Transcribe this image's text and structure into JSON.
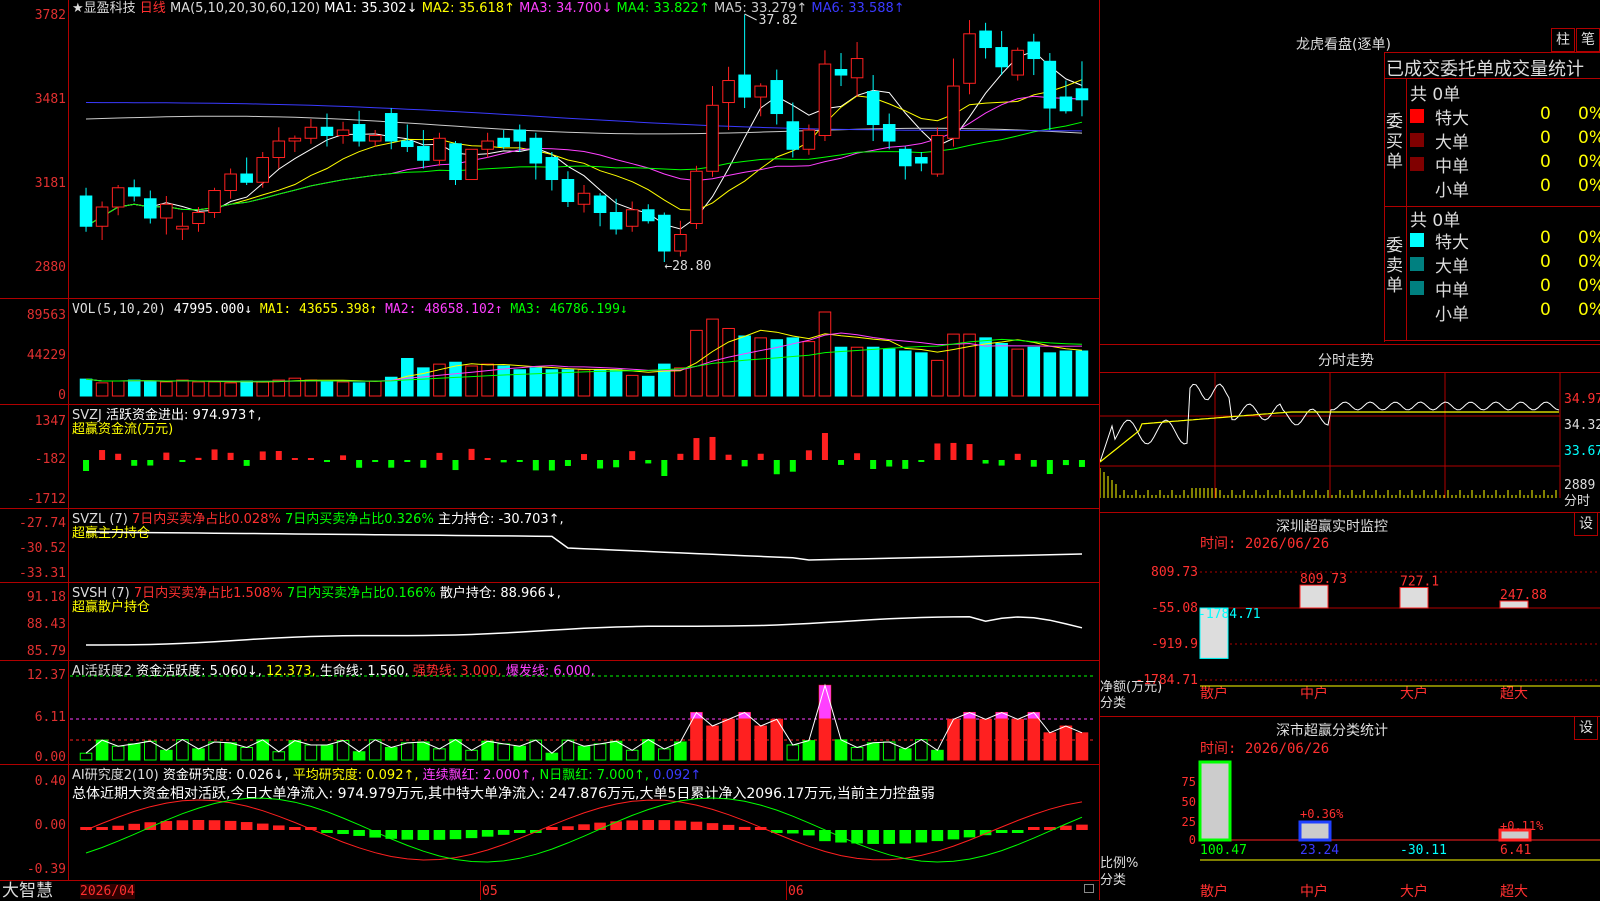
{
  "stock": {
    "title": "★显盈科技",
    "period": "日线",
    "ma_label": "MA(5,10,20,30,60,120)",
    "ma1": "MA1: 35.302↓",
    "ma2": "MA2: 35.618↑",
    "ma3": "MA3: 34.700↓",
    "ma4": "MA4: 33.822↑",
    "ma5": "MA5: 33.279↑",
    "ma6": "MA6: 33.588↑",
    "high_mark": "37.82",
    "low_mark": "←28.80",
    "y_labels": [
      "3782",
      "3481",
      "3181",
      "2880"
    ]
  },
  "vol": {
    "label": "VOL(5,10,20)",
    "value": "47995.000↓",
    "ma1": "MA1: 43655.398↑",
    "ma2": "MA2: 48658.102↑",
    "ma3": "MA3: 46786.199↓",
    "y_labels": [
      "89563",
      "44229",
      "0"
    ]
  },
  "svzj": {
    "label": "SVZJ",
    "desc": "活跃资金进出: 974.973↑,",
    "sub": "超赢资金流(万元)",
    "y_labels": [
      "1347",
      "-182",
      "-1712"
    ]
  },
  "svzl": {
    "label": "SVZL (7)",
    "t1": "7日内买卖净占比0.028%",
    "t2": "7日内买卖净占比0.326%",
    "t3": "主力持仓: -30.703↑,",
    "sub": "超赢主力持仓",
    "y_labels": [
      "-27.74",
      "-30.52",
      "-33.31"
    ]
  },
  "svsh": {
    "label": "SVSH (7)",
    "t1": "7日内买卖净占比1.508%",
    "t2": "7日内买卖净占比0.166%",
    "t3": "散户持仓: 88.966↓,",
    "sub": "超赢散户持仓",
    "y_labels": [
      "91.18",
      "88.43",
      "85.79"
    ]
  },
  "ai2": {
    "label": "AI活跃度2",
    "t1": "资金活跃度: 5.060↓,",
    "t2": "12.373,",
    "t3": "生命线: 1.560,",
    "t4": "强势线: 3.000,",
    "t5": "爆发线: 6.000,",
    "y_labels": [
      "12.37",
      "6.11",
      "0.00"
    ]
  },
  "ai_research": {
    "label": "AI研究度2(10)",
    "t1": "资金研究度: 0.026↓,",
    "t2": "平均研究度: 0.092↑,",
    "t3": "连续飘红: 2.000↑,",
    "t4": "N日飘红: 7.000↑,",
    "t5": "0.092↑",
    "summary": "总体近期大资金相对活跃,今日大单净流入: 974.979万元,其中特大单净流入: 247.876万元,大单5日累计净入2096.17万元,当前主力控盘弱",
    "y_labels": [
      "0.40",
      "0.00",
      "-0.39"
    ]
  },
  "footer": {
    "brand": "大智慧",
    "dates": [
      "2026/04",
      "05",
      "06"
    ]
  },
  "longhu": {
    "title": "龙虎看盘(逐单)",
    "btn_bar": "柱",
    "btn_note": "笔",
    "header": "已成交委托单成交量统计",
    "buy_label": "委买单",
    "sell_label": "委卖单",
    "buy_total": "共 0单",
    "sell_total": "共 0单",
    "buy_rows": [
      {
        "name": "特大",
        "count": "0",
        "pct": "0%",
        "color": "#ff0000"
      },
      {
        "name": "大单",
        "count": "0",
        "pct": "0%",
        "color": "#800000"
      },
      {
        "name": "中单",
        "count": "0",
        "pct": "0%",
        "color": "#800000"
      },
      {
        "name": "小单",
        "count": "0",
        "pct": "0%",
        "color": ""
      }
    ],
    "sell_rows": [
      {
        "name": "特大",
        "count": "0",
        "pct": "0%",
        "color": "#00ffff"
      },
      {
        "name": "大单",
        "count": "0",
        "pct": "0%",
        "color": "#008080"
      },
      {
        "name": "中单",
        "count": "0",
        "pct": "0%",
        "color": "#008080"
      },
      {
        "name": "小单",
        "count": "0",
        "pct": "0%",
        "color": ""
      }
    ]
  },
  "intraday": {
    "title": "分时走势",
    "y_labels": [
      "34.97",
      "34.32",
      "33.67"
    ],
    "vol_label": "2889",
    "time_label": "分时"
  },
  "sz_monitor": {
    "title": "深圳超赢实时监控",
    "btn": "设",
    "time": "时间: 2026/06/26",
    "y_labels": [
      "809.73",
      "-55.08",
      "-919.9",
      "-1784.71"
    ],
    "footer_left1": "净额(万元)",
    "footer_left2": "分类",
    "categories": [
      "散户",
      "中户",
      "大户",
      "超大"
    ],
    "values": [
      "-1784.71",
      "809.73",
      "727.1",
      "247.88"
    ]
  },
  "sz_stats": {
    "title": "深市超赢分类统计",
    "btn": "设",
    "time": "时间: 2026/06/26",
    "y_labels": [
      "75",
      "50",
      "25",
      "0"
    ],
    "footer_left1": "比例%",
    "footer_left2": "分类",
    "categories": [
      "散户",
      "中户",
      "大户",
      "超大"
    ],
    "values": [
      "100.47",
      "23.24",
      "-30.11",
      "6.41"
    ],
    "annotations": [
      "+0.36%",
      "+0.11%"
    ]
  },
  "colors": {
    "up": "#ff2020",
    "down": "#00ffff",
    "grid": "#b00000",
    "label_red": "#e03030",
    "yellow": "#ffff00",
    "magenta": "#ff40ff",
    "green": "#00ff00"
  },
  "chart_data": {
    "type": "line",
    "title": "",
    "candles": [
      [
        31.2,
        31.5,
        29.9,
        30.1
      ],
      [
        30.1,
        31.0,
        29.6,
        30.8
      ],
      [
        30.8,
        31.6,
        30.5,
        31.5
      ],
      [
        31.5,
        31.8,
        31.0,
        31.2
      ],
      [
        31.1,
        31.4,
        30.2,
        30.4
      ],
      [
        30.4,
        31.2,
        29.8,
        30.9
      ],
      [
        30.0,
        30.6,
        29.6,
        30.1
      ],
      [
        30.2,
        30.8,
        29.9,
        30.6
      ],
      [
        30.6,
        31.5,
        30.4,
        31.4
      ],
      [
        31.4,
        32.2,
        31.1,
        32.0
      ],
      [
        32.0,
        32.6,
        31.6,
        31.7
      ],
      [
        31.7,
        32.8,
        31.5,
        32.6
      ],
      [
        32.6,
        33.7,
        32.2,
        33.2
      ],
      [
        33.2,
        33.4,
        32.8,
        33.3
      ],
      [
        33.3,
        34.0,
        33.1,
        33.7
      ],
      [
        33.7,
        34.2,
        33.0,
        33.4
      ],
      [
        33.4,
        33.9,
        33.1,
        33.6
      ],
      [
        33.8,
        34.3,
        33.0,
        33.2
      ],
      [
        33.2,
        33.6,
        33.0,
        33.4
      ],
      [
        34.2,
        34.4,
        32.9,
        33.2
      ],
      [
        33.2,
        33.8,
        32.8,
        33.0
      ],
      [
        33.0,
        33.6,
        32.2,
        32.5
      ],
      [
        32.5,
        33.5,
        32.3,
        33.3
      ],
      [
        33.1,
        33.2,
        31.6,
        31.8
      ],
      [
        31.8,
        32.9,
        31.8,
        32.9
      ],
      [
        32.9,
        33.5,
        32.6,
        33.2
      ],
      [
        33.3,
        33.6,
        32.9,
        33.0
      ],
      [
        33.6,
        33.8,
        32.8,
        33.2
      ],
      [
        33.3,
        33.5,
        31.8,
        32.4
      ],
      [
        32.6,
        32.8,
        31.4,
        31.8
      ],
      [
        31.8,
        32.1,
        30.8,
        31.0
      ],
      [
        30.9,
        31.6,
        30.6,
        31.3
      ],
      [
        31.2,
        31.3,
        30.1,
        30.6
      ],
      [
        30.6,
        31.1,
        29.8,
        30.0
      ],
      [
        30.1,
        31.0,
        29.9,
        30.7
      ],
      [
        30.7,
        30.9,
        30.2,
        30.3
      ],
      [
        30.5,
        30.6,
        28.8,
        29.2
      ],
      [
        29.2,
        30.3,
        29.0,
        29.8
      ],
      [
        30.2,
        32.3,
        30.0,
        32.1
      ],
      [
        32.1,
        35.2,
        31.9,
        34.5
      ],
      [
        34.6,
        35.9,
        33.6,
        35.4
      ],
      [
        35.6,
        37.8,
        34.4,
        34.8
      ],
      [
        34.8,
        35.3,
        34.1,
        35.2
      ],
      [
        35.4,
        35.8,
        33.8,
        34.2
      ],
      [
        33.9,
        34.6,
        32.6,
        32.9
      ],
      [
        32.9,
        33.8,
        32.7,
        33.6
      ],
      [
        33.4,
        36.5,
        33.2,
        36.0
      ],
      [
        35.8,
        36.4,
        35.2,
        35.6
      ],
      [
        35.5,
        36.8,
        34.8,
        36.2
      ],
      [
        35.0,
        35.6,
        33.2,
        33.8
      ],
      [
        33.8,
        34.2,
        32.9,
        33.2
      ],
      [
        32.9,
        33.0,
        31.8,
        32.3
      ],
      [
        32.6,
        32.8,
        32.1,
        32.4
      ],
      [
        32.0,
        33.7,
        31.9,
        33.4
      ],
      [
        33.3,
        36.2,
        33.0,
        35.2
      ],
      [
        35.3,
        37.6,
        34.9,
        37.1
      ],
      [
        37.2,
        37.5,
        36.2,
        36.6
      ],
      [
        36.6,
        37.2,
        35.6,
        35.9
      ],
      [
        35.6,
        36.6,
        35.4,
        36.5
      ],
      [
        36.8,
        37.1,
        35.6,
        36.2
      ],
      [
        36.1,
        36.4,
        33.6,
        34.4
      ],
      [
        34.8,
        35.4,
        34.2,
        34.3
      ],
      [
        35.1,
        36.1,
        34.1,
        34.7
      ]
    ],
    "volumes": [
      18000,
      14000,
      16000,
      17000,
      16000,
      15000,
      17000,
      15000,
      15000,
      14000,
      16000,
      15000,
      17000,
      19000,
      17000,
      16000,
      15000,
      14000,
      16000,
      20000,
      40000,
      30000,
      34000,
      36000,
      32000,
      34000,
      32000,
      28000,
      30000,
      28000,
      28000,
      28000,
      28000,
      28000,
      22000,
      21000,
      34000,
      30000,
      70000,
      82000,
      72000,
      64000,
      62000,
      60000,
      62000,
      58000,
      89563,
      52000,
      52000,
      52000,
      50000,
      48000,
      46000,
      38000,
      66000,
      66000,
      62000,
      56000,
      50000,
      52000,
      46000,
      48000,
      47995
    ],
    "series": [
      {
        "name": "MA1",
        "values": []
      }
    ]
  }
}
